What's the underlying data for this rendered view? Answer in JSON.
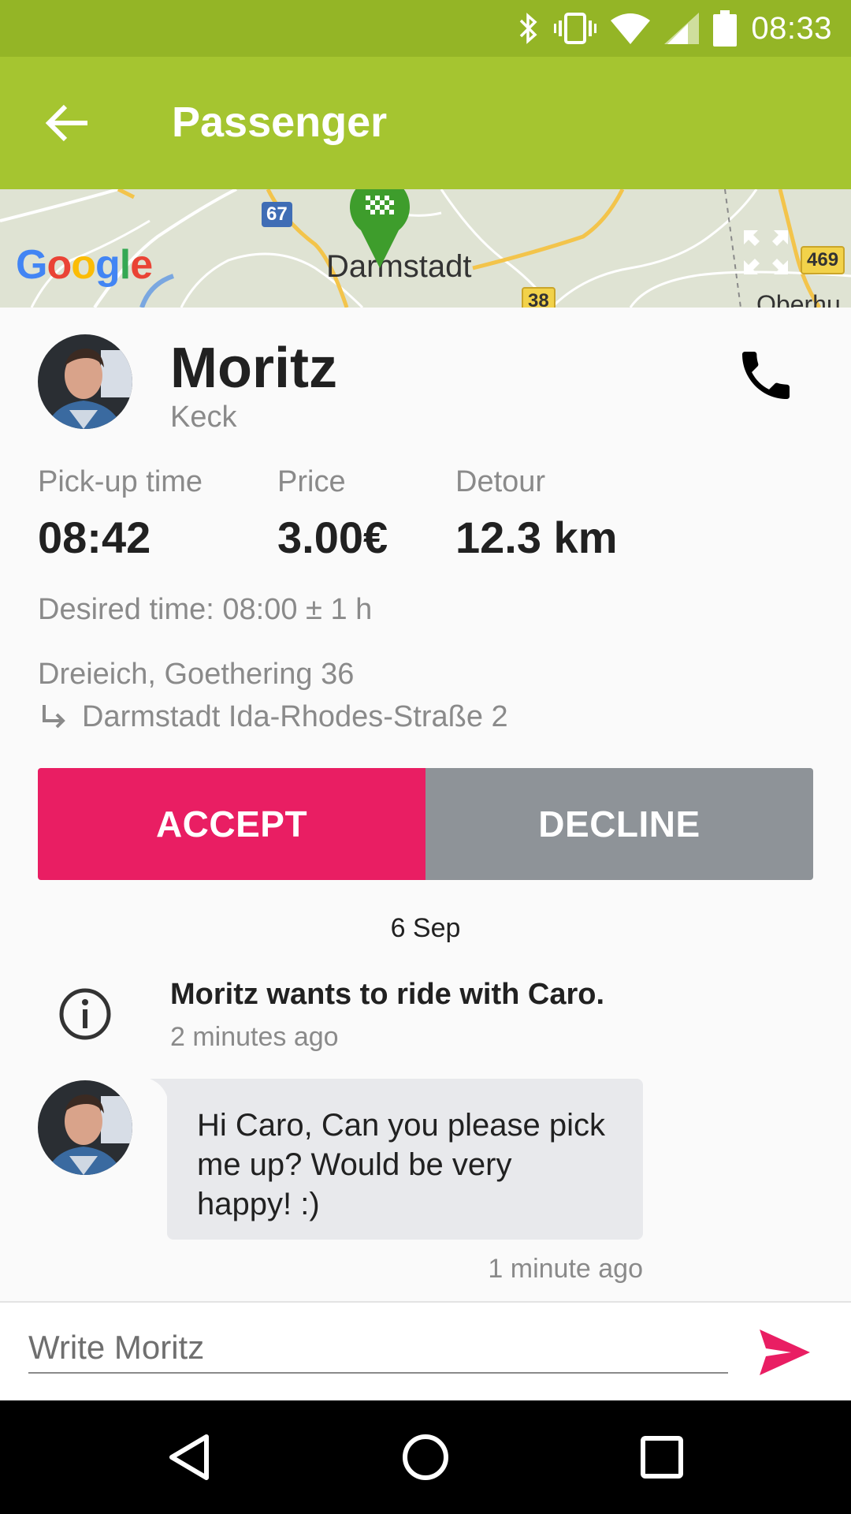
{
  "status_bar": {
    "time": "08:33",
    "icons": [
      "bluetooth-icon",
      "vibrate-icon",
      "wifi-icon",
      "signal-icon",
      "battery-icon"
    ]
  },
  "app_bar": {
    "title": "Passenger",
    "back_icon": "arrow-left-icon"
  },
  "map": {
    "brand": "Google",
    "city": "Darmstadt",
    "city_partial": "Oberhu",
    "shields": [
      "67",
      "469",
      "38"
    ],
    "pin_icon": "checkered-flag-pin-icon",
    "fullscreen_icon": "fullscreen-icon"
  },
  "passenger": {
    "first_name": "Moritz",
    "last_name": "Keck",
    "phone_icon": "phone-icon"
  },
  "stats": {
    "pickup_label": "Pick-up time",
    "pickup_value": "08:42",
    "price_label": "Price",
    "price_value": "3.00€",
    "detour_label": "Detour",
    "detour_value": "12.3 km"
  },
  "desired_time": "Desired time: 08:00 ± 1 h",
  "route": {
    "from": "Dreieich, Goethering 36",
    "to": "Darmstadt Ida-Rhodes-Straße 2"
  },
  "actions": {
    "accept": "ACCEPT",
    "decline": "DECLINE"
  },
  "chat": {
    "date": "6 Sep",
    "system_message": "Moritz wants to ride with Caro.",
    "system_time": "2 minutes ago",
    "message_text": "Hi Caro, Can you please pick me up? Would be very happy! :)",
    "message_time": "1 minute ago"
  },
  "compose": {
    "placeholder": "Write Moritz",
    "send_icon": "send-icon"
  },
  "colors": {
    "status_bar": "#94b526",
    "app_bar": "#a5c530",
    "accept": "#e91e63",
    "decline": "#8e9398",
    "send": "#e91e63"
  }
}
